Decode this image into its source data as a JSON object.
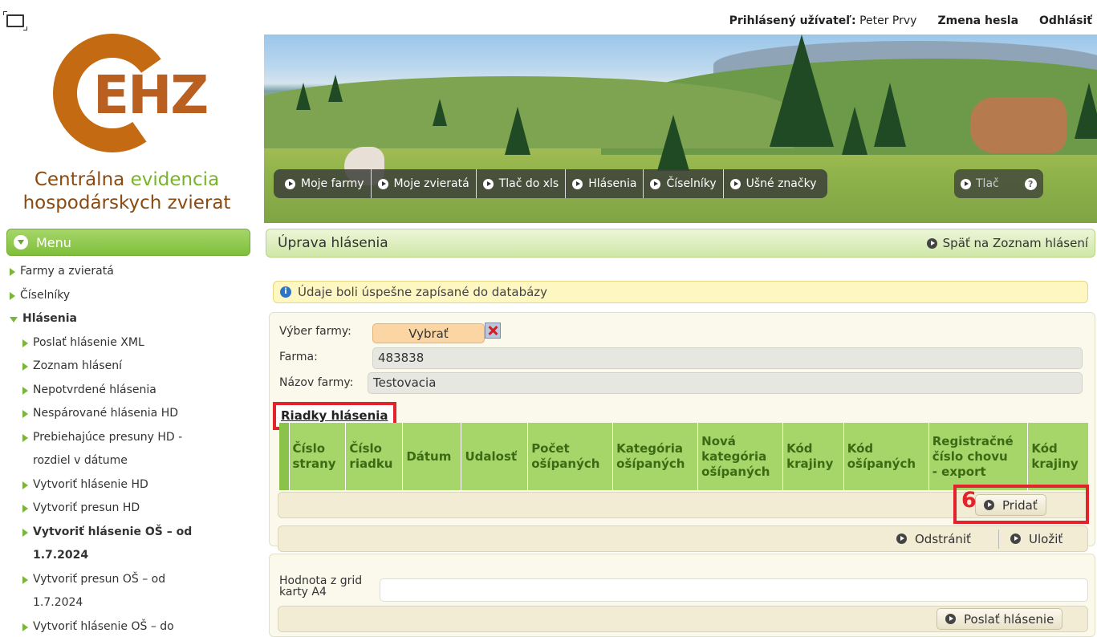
{
  "topbar": {
    "user_label": "Prihlásený užívateľ:",
    "user_name": "Peter Prvy",
    "change_password": "Zmena hesla",
    "logout": "Odhlásiť"
  },
  "logo": {
    "mark": "EHZ",
    "caption_line1_a": "Centrálna",
    "caption_line1_b": "evidencia",
    "caption_line2": "hospodárskych zvierat"
  },
  "nav": {
    "items": [
      "Moje farmy",
      "Moje zvieratá",
      "Tlač do xls",
      "Hlásenia",
      "Číselníky",
      "Ušné značky"
    ],
    "print": "Tlač",
    "help": "?"
  },
  "sidebar": {
    "title": "Menu",
    "items": [
      {
        "label": "Farmy a zvieratá"
      },
      {
        "label": "Číselníky"
      },
      {
        "label": "Hlásenia"
      },
      {
        "label": "Poslať hlásenie XML"
      },
      {
        "label": "Zoznam hlásení"
      },
      {
        "label": "Nepotvrdené hlásenia"
      },
      {
        "label": "Nespárované hlásenia HD"
      },
      {
        "label": "Prebiehajúce presuny HD -",
        "label2": "rozdiel v dátume"
      },
      {
        "label": "Vytvoriť hlásenie HD"
      },
      {
        "label": "Vytvoriť presun HD"
      },
      {
        "label": "Vytvoriť hlásenie OŠ – od",
        "label2": "1.7.2024"
      },
      {
        "label": "Vytvoriť presun OŠ – od",
        "label2": "1.7.2024"
      },
      {
        "label": "Vytvoriť hlásenie OŠ – do"
      }
    ]
  },
  "page": {
    "title": "Úprava hlásenia",
    "back_link": "Späť na Zoznam hlásení",
    "info_message": "Údaje boli úspešne zapísané do databázy"
  },
  "form": {
    "farm_select_label": "Výber farmy:",
    "farm_select_button": "Vybrať",
    "farm_label": "Farma:",
    "farm_value": "483838",
    "farm_name_label": "Názov farmy:",
    "farm_name_value": "Testovacia"
  },
  "grid": {
    "title": "Riadky hlásenia",
    "columns": [
      [
        "Číslo",
        "strany"
      ],
      [
        "Číslo",
        "riadku"
      ],
      [
        "Dátum"
      ],
      [
        "Udalosť"
      ],
      [
        "Počet",
        "ošípaných"
      ],
      [
        "Kategória",
        "ošípaných"
      ],
      [
        "Nová",
        "kategória",
        "ošípaných"
      ],
      [
        "Kód",
        "krajiny"
      ],
      [
        "Kód",
        "ošípaných"
      ],
      [
        "Registračné",
        "číslo chovu",
        "- export"
      ],
      [
        "Kód",
        "krajiny"
      ]
    ]
  },
  "buttons": {
    "add": "Pridať",
    "remove": "Odstrániť",
    "save": "Uložiť",
    "send": "Poslať hlásenie"
  },
  "annotation": {
    "step_number": "6"
  },
  "bottom": {
    "grid_value_label_line1": "Hodnota z grid",
    "grid_value_label_line2": "karty A4",
    "grid_value": ""
  },
  "colors": {
    "accent_green": "#7fbf3a",
    "logo_orange": "#c46a13",
    "highlight_red": "#e3232c",
    "info_yellow": "#fff7c2"
  }
}
